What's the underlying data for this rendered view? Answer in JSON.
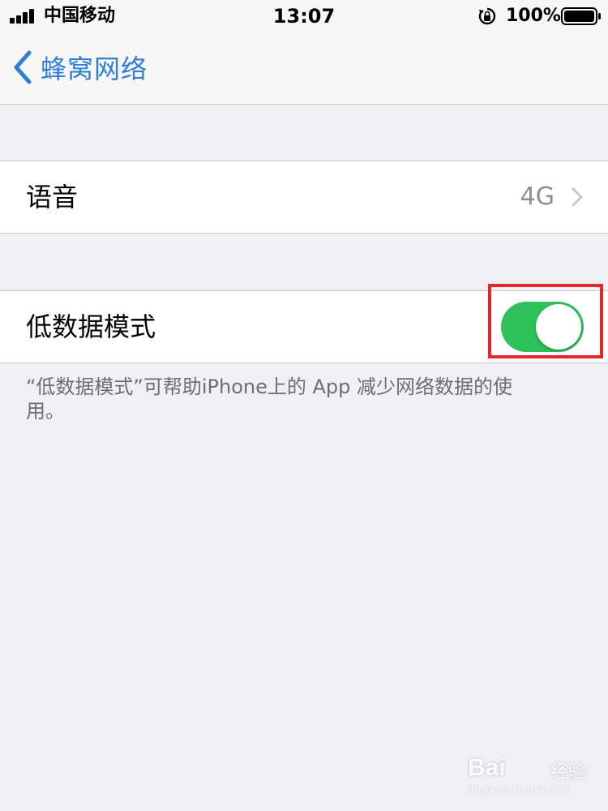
{
  "status_bar": {
    "carrier": "中国移动",
    "time": "13:07",
    "battery_percent": "100%",
    "icons": [
      "signal-icon",
      "rotation-lock-icon",
      "battery-icon"
    ]
  },
  "nav_bar": {
    "back_label": "蜂窝网络",
    "back_icon": "chevron-left-icon"
  },
  "settings": {
    "voice": {
      "label": "语音",
      "value": "4G",
      "icon": "chevron-right-icon"
    },
    "low_data_mode": {
      "label": "低数据模式",
      "enabled": true,
      "footer": "“低数据模式”可帮助iPhone上的 App 减少网络数据的使用。"
    }
  },
  "watermark": {
    "brand": "Bai",
    "sub": "经验",
    "url": "jingyan.baidu.com"
  },
  "colors": {
    "accent": "#2e7dd7",
    "toggle_on": "#2fc15a",
    "highlight": "#e8262a",
    "background": "#efeff4"
  }
}
